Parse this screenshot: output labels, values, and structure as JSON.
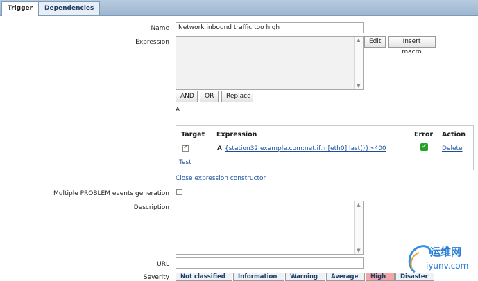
{
  "tabs": [
    {
      "label": "Trigger"
    },
    {
      "label": "Dependencies"
    }
  ],
  "form": {
    "name_label": "Name",
    "name_value": "Network inbound traffic too high",
    "expression_label": "Expression",
    "edit_label": "Edit",
    "insert_macro_label": "Insert macro",
    "and_label": "AND",
    "or_label": "OR",
    "replace_label": "Replace",
    "expression_preview": "A",
    "multiple_problem_label": "Multiple PROBLEM events generation",
    "description_label": "Description",
    "url_label": "URL",
    "severity_label": "Severity",
    "close_constructor_label": "Close expression constructor"
  },
  "constructor": {
    "headers": {
      "target": "Target",
      "expression": "Expression",
      "error": "Error",
      "action": "Action"
    },
    "rows": [
      {
        "target_checked": true,
        "letter": "A",
        "expression": "{station32.example.com:net.if.in[eth0].last()}>400",
        "error_status": "ok",
        "action": "Delete"
      }
    ],
    "test_label": "Test"
  },
  "severity_options": [
    {
      "label": "Not classified",
      "selected": false
    },
    {
      "label": "Information",
      "selected": false
    },
    {
      "label": "Warning",
      "selected": false
    },
    {
      "label": "Average",
      "selected": false
    },
    {
      "label": "High",
      "selected": true
    },
    {
      "label": "Disaster",
      "selected": false
    }
  ],
  "watermark": {
    "line1": "运维网",
    "line2": "iyunv.com",
    "color": "#2a7fd4"
  }
}
